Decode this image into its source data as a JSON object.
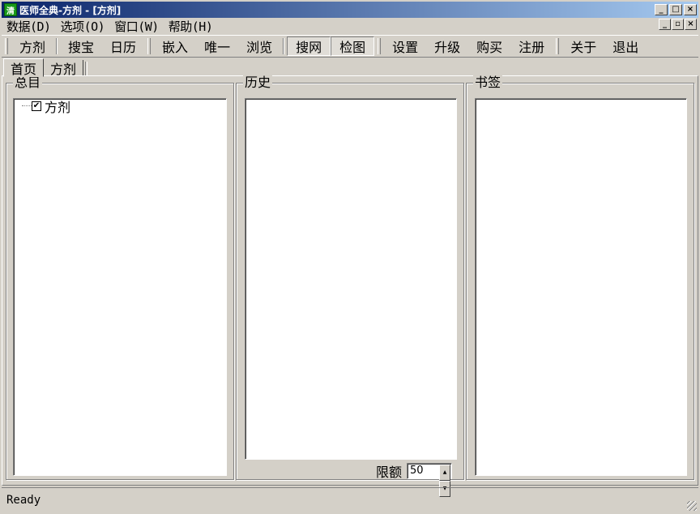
{
  "window": {
    "title": "医师全典-方剂 - [方剂]",
    "icon_text": "清",
    "buttons": [
      "_",
      "□",
      "×"
    ],
    "mdi_buttons": [
      "_",
      "▫",
      "×"
    ]
  },
  "menu": [
    "数据(D)",
    "选项(O)",
    "窗口(W)",
    "帮助(H)"
  ],
  "toolbar": {
    "group1": [
      "方剂",
      "搜宝",
      "日历"
    ],
    "group2": [
      "嵌入",
      "唯一",
      "浏览"
    ],
    "group3": [
      "搜网",
      "检图"
    ],
    "group4": [
      "设置",
      "升级",
      "购买",
      "注册"
    ],
    "group5": [
      "关于",
      "退出"
    ]
  },
  "tabs": [
    "首页",
    "方剂"
  ],
  "panels": {
    "catalog": {
      "title": "总目",
      "tree": [
        {
          "label": "方剂",
          "checked": true
        }
      ]
    },
    "history": {
      "title": "历史",
      "limit_label": "限额",
      "limit_value": "50"
    },
    "bookmarks": {
      "title": "书签"
    }
  },
  "status": "Ready",
  "colors": {
    "titlebar": "#0a246a",
    "face": "#d4d0c8",
    "icon": "#1a9a1a"
  }
}
